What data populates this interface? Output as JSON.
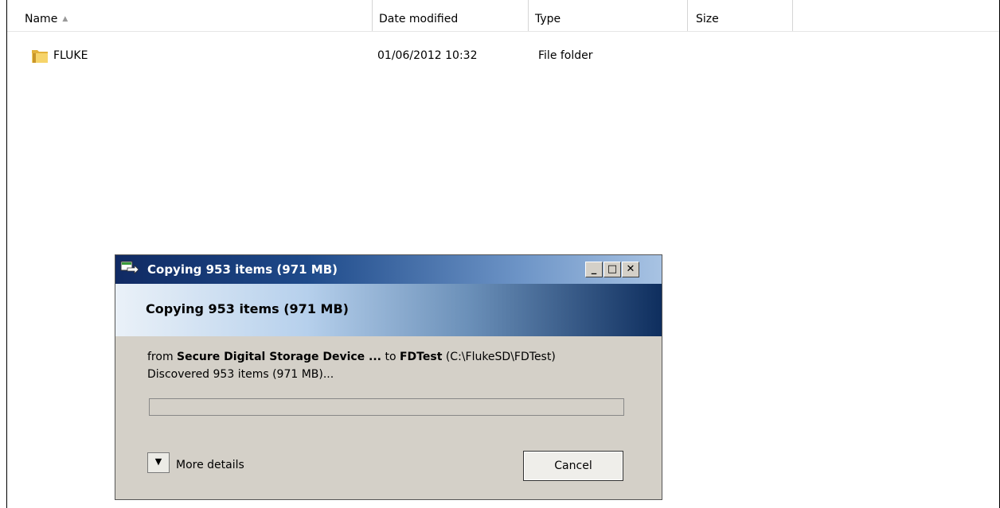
{
  "explorer": {
    "columns": {
      "name": "Name",
      "date_modified": "Date modified",
      "type": "Type",
      "size": "Size"
    },
    "rows": [
      {
        "name": "FLUKE",
        "date_modified": "01/06/2012 10:32",
        "type": "File folder",
        "size": ""
      }
    ]
  },
  "dialog": {
    "title": "Copying 953 items (971 MB)",
    "banner": "Copying 953 items (971 MB)",
    "from_prefix": "from ",
    "source": "Secure Digital Storage Device ...",
    "to_word": " to ",
    "destination": "FDTest",
    "destination_path": " (C:\\FlukeSD\\FDTest)",
    "status": "Discovered 953 items (971 MB)...",
    "progress_fraction": 0,
    "more_details_label": "More details",
    "cancel_label": "Cancel",
    "titlebar_buttons": {
      "minimize": "_",
      "maximize": "□",
      "close": "✕"
    }
  },
  "colors": {
    "dialog_background": "#d4d0c8",
    "titlebar_dark": "#102a63",
    "banner_dark": "#0e2e5e",
    "folder_yellow": "#f1c64c"
  }
}
